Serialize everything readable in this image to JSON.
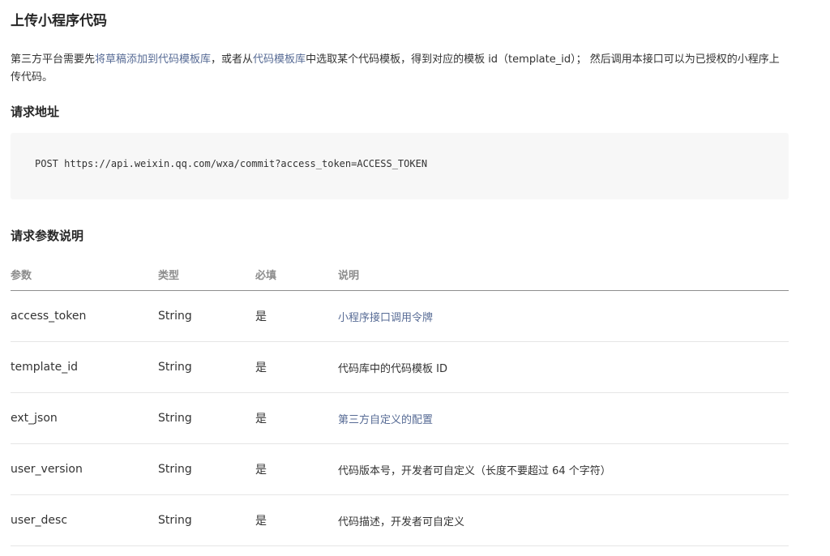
{
  "title": "上传小程序代码",
  "intro": {
    "t1": "第三方平台需要先",
    "link1": "将草稿添加到代码模板库",
    "t2": "，或者从",
    "link2": "代码模板库",
    "t3": "中选取某个代码模板，得到对应的模板 id（template_id）； 然后调用本接口可以为已授权的小程序上传代码。"
  },
  "sections": {
    "request_url": "请求地址",
    "request_params": "请求参数说明"
  },
  "request": {
    "line": "POST https://api.weixin.qq.com/wxa/commit?access_token=ACCESS_TOKEN"
  },
  "table": {
    "headers": [
      "参数",
      "类型",
      "必填",
      "说明"
    ],
    "rows": [
      {
        "name": "access_token",
        "type": "String",
        "required": "是",
        "desc": "小程序接口调用令牌",
        "desc_is_link": true
      },
      {
        "name": "template_id",
        "type": "String",
        "required": "是",
        "desc": "代码库中的代码模板 ID",
        "desc_is_link": false
      },
      {
        "name": "ext_json",
        "type": "String",
        "required": "是",
        "desc": "第三方自定义的配置",
        "desc_is_link": true
      },
      {
        "name": "user_version",
        "type": "String",
        "required": "是",
        "desc": "代码版本号，开发者可自定义（长度不要超过 64 个字符）",
        "desc_is_link": false
      },
      {
        "name": "user_desc",
        "type": "String",
        "required": "是",
        "desc": "代码描述，开发者可自定义",
        "desc_is_link": false
      }
    ]
  },
  "colors": {
    "link": "#576b95",
    "text": "#333333",
    "header_text": "#8c8c8c",
    "code_bg": "#f7f7f7"
  }
}
